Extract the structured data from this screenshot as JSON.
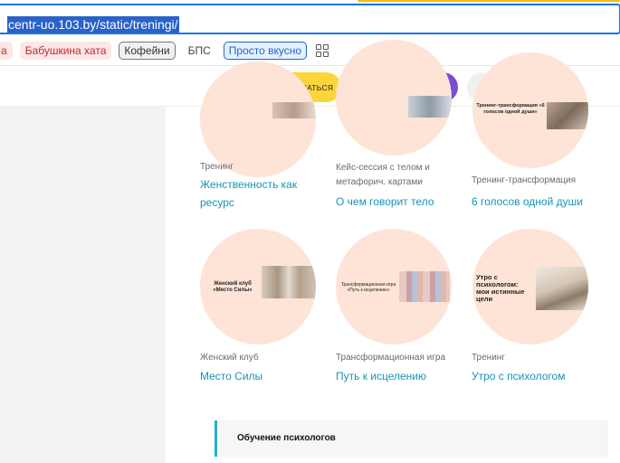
{
  "browser": {
    "url": "centr-uo.103.by/static/treningi/",
    "bookmarks": [
      {
        "label": "а",
        "style": "red-cut"
      },
      {
        "label": "Бабушкина хата",
        "style": "red"
      },
      {
        "label": "Кофейни",
        "style": "gray"
      },
      {
        "label": "БПС",
        "style": "plain"
      },
      {
        "label": "Просто вкусно",
        "style": "blue"
      }
    ]
  },
  "toolbar": {
    "signup_label": "ЗАПИСАТЬСЯ",
    "colors": {
      "signup_bg": "#fad63a",
      "telegram": "#2aa3df",
      "viber": "#7a4dd1",
      "accent": "#1595b5"
    }
  },
  "cards": [
    {
      "category": "Тренинг",
      "title": "Женственность как ресурс",
      "poster_text": ""
    },
    {
      "category": "Кейс-сессия с телом и метафорич. картами",
      "title": "О чем говорит тело",
      "poster_text": ""
    },
    {
      "category": "Тренинг-трансформация",
      "title": "6 голосов одной души",
      "poster_text": "Тренинг-трансформация «6 голосов одной души»"
    },
    {
      "category": "Женский клуб",
      "title": "Место Силы",
      "poster_text": "Женский клуб «Место Силы»"
    },
    {
      "category": "Трансформационная игра",
      "title": "Путь к исцелению",
      "poster_text": "Трансформационная игра «Путь к исцелению»"
    },
    {
      "category": "Тренинг",
      "title": "Утро с психологом",
      "poster_text": "Утро с психологом: мои истинные цели"
    }
  ],
  "section": {
    "title": "Обучение психологов"
  }
}
